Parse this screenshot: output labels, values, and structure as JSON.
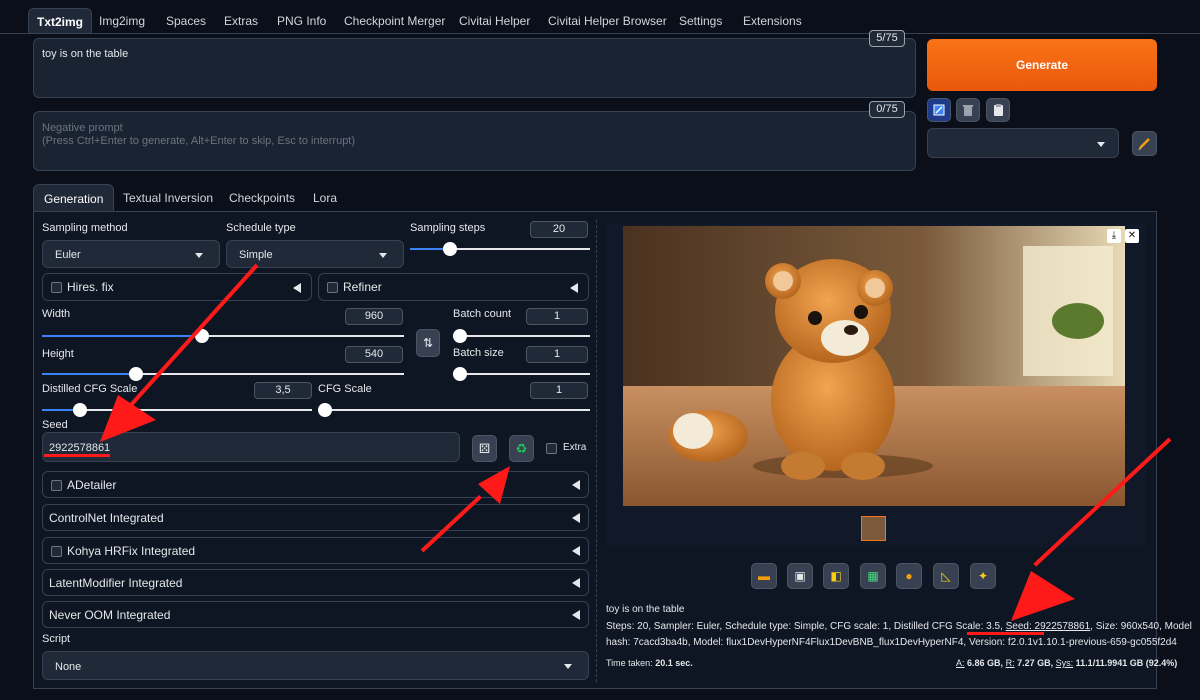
{
  "tabs": [
    "Txt2img",
    "Img2img",
    "Spaces",
    "Extras",
    "PNG Info",
    "Checkpoint Merger",
    "Civitai Helper",
    "Civitai Helper Browser",
    "Settings",
    "Extensions"
  ],
  "prompt": {
    "value": "toy is on the table",
    "counter": "5/75"
  },
  "negative": {
    "placeholder_line1": "Negative prompt",
    "placeholder_line2": "(Press Ctrl+Enter to generate, Alt+Enter to skip, Esc to interrupt)",
    "counter": "0/75"
  },
  "generate_label": "Generate",
  "subtabs": [
    "Generation",
    "Textual Inversion",
    "Checkpoints",
    "Lora"
  ],
  "sampling": {
    "method_label": "Sampling method",
    "method_value": "Euler",
    "schedule_label": "Schedule type",
    "schedule_value": "Simple",
    "steps_label": "Sampling steps",
    "steps_value": "20"
  },
  "hires_label": "Hires. fix",
  "refiner_label": "Refiner",
  "width": {
    "label": "Width",
    "value": "960"
  },
  "height": {
    "label": "Height",
    "value": "540"
  },
  "batch_count": {
    "label": "Batch count",
    "value": "1"
  },
  "batch_size": {
    "label": "Batch size",
    "value": "1"
  },
  "distilled_cfg": {
    "label": "Distilled CFG Scale",
    "value": "3,5"
  },
  "cfg": {
    "label": "CFG Scale",
    "value": "1"
  },
  "seed": {
    "label": "Seed",
    "value": "2922578861",
    "extra_label": "Extra"
  },
  "accordions": [
    "ADetailer",
    "ControlNet Integrated",
    "Kohya HRFix Integrated",
    "LatentModifier Integrated",
    "Never OOM Integrated"
  ],
  "script": {
    "label": "Script",
    "value": "None"
  },
  "output": {
    "prompt": "toy is on the table",
    "params_a": "Steps: 20, Sampler: Euler, Schedule type: Simple, CFG scale: 1, Distilled CFG Scale: 3.5, ",
    "params_seed": "Seed: 2922578861",
    "params_b": ", Size: 960x540, Model",
    "params_line2": "hash: 7cacd3ba4b, Model: flux1DevHyperNF4Flux1DevBNB_flux1DevHyperNF4, Version: f2.0.1v1.10.1-previous-659-gc055f2d4",
    "time_label": "Time taken:",
    "time_value": "20.1 sec.",
    "mem_a_label": "A:",
    "mem_a": "6.86 GB,",
    "mem_r_label": "R:",
    "mem_r": "7.27 GB,",
    "mem_sys_label": "Sys:",
    "mem_sys": "11.1/11.9941 GB (92.4%)"
  },
  "sliders": {
    "steps": 0.2,
    "width": 0.44,
    "height": 0.25,
    "batch_count": 0.0,
    "batch_size": 0.0,
    "distilled_cfg": 0.12,
    "cfg": 0.0
  },
  "colors": {
    "accent": "#f97316",
    "arrow": "#ff1a1a",
    "slider": "#3b82f6"
  }
}
